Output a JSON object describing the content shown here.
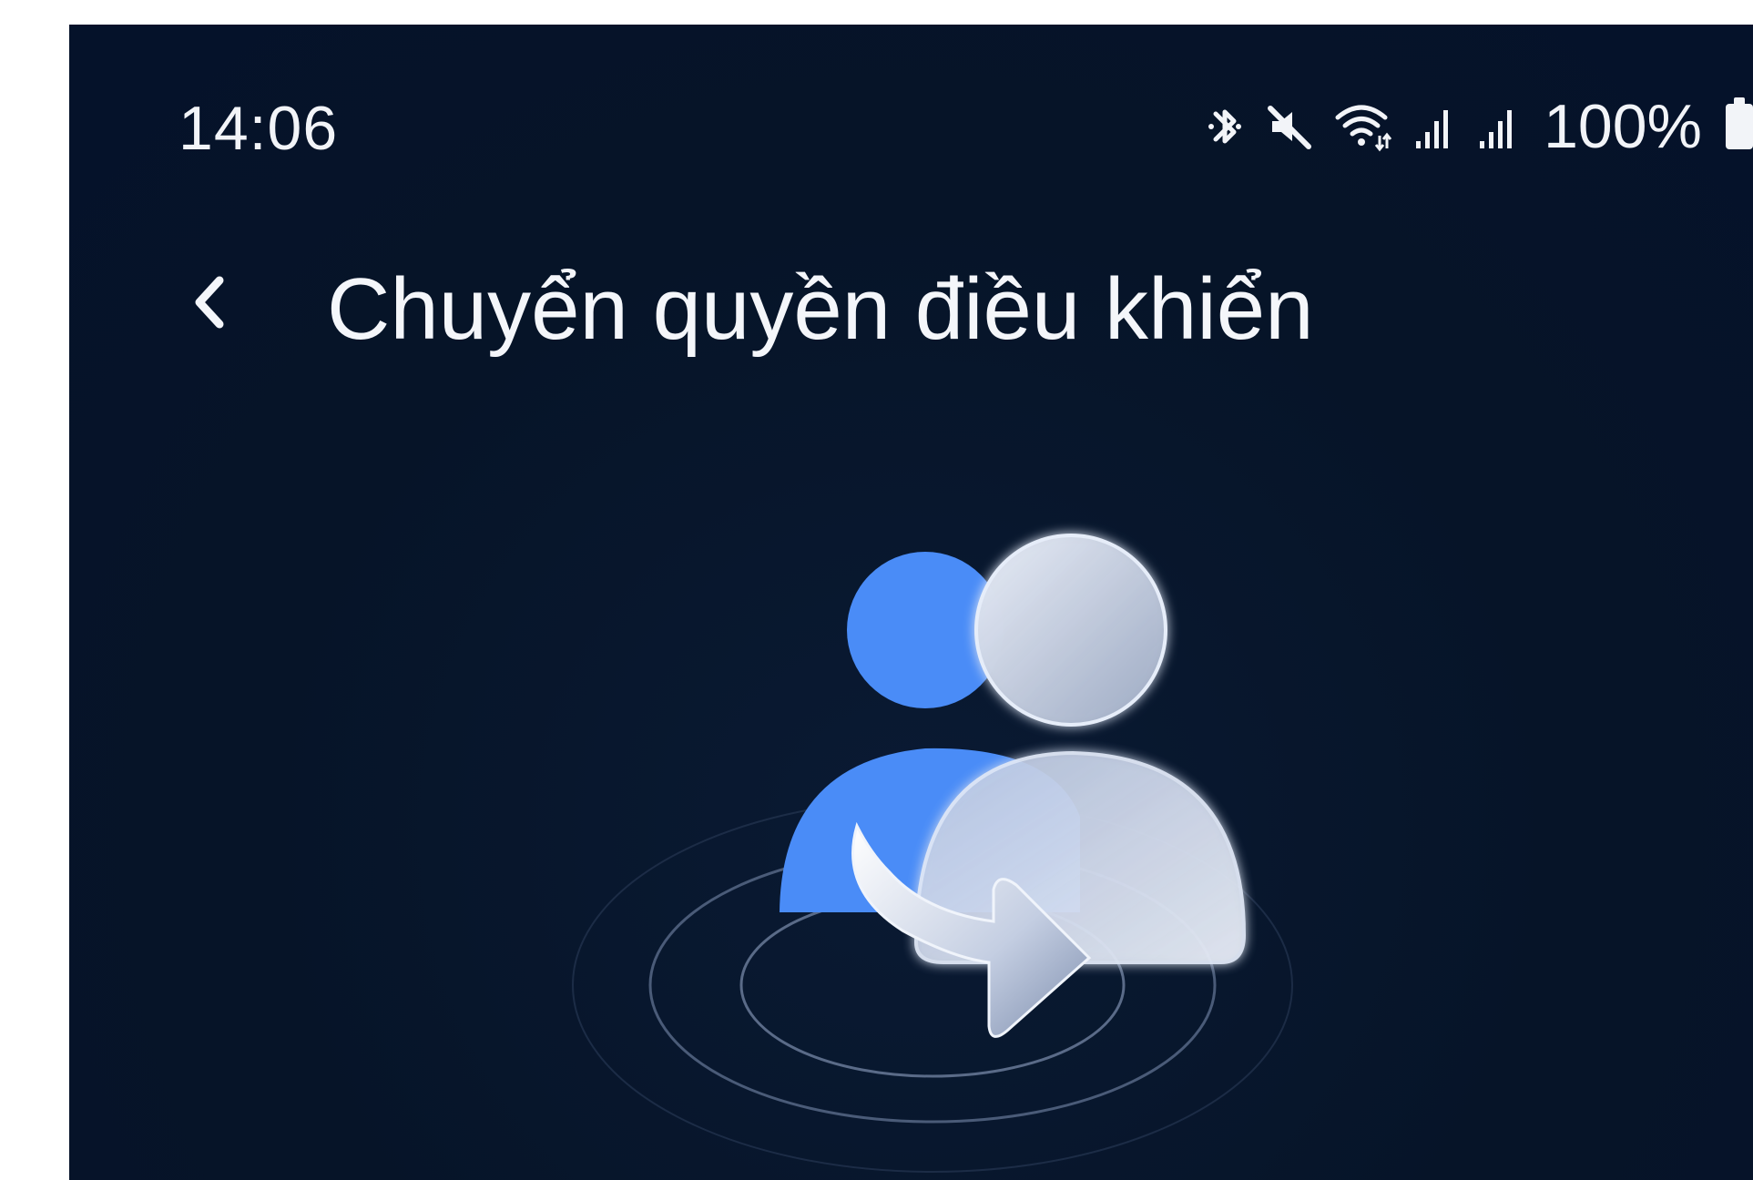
{
  "status_bar": {
    "time": "14:06",
    "battery": "100%",
    "icons": [
      "bluetooth-icon",
      "mute-icon",
      "wifi-icon",
      "signal-icon",
      "signal-icon",
      "battery-icon"
    ]
  },
  "header": {
    "back_icon": "chevron-left-icon",
    "title": "Chuyển quyền điều khiển"
  },
  "illustration": {
    "icon": "transfer-control-users-icon",
    "colors": {
      "primary_user": "#4a8cf7",
      "secondary_user": "#c9d3e6",
      "background": "#061428"
    }
  }
}
